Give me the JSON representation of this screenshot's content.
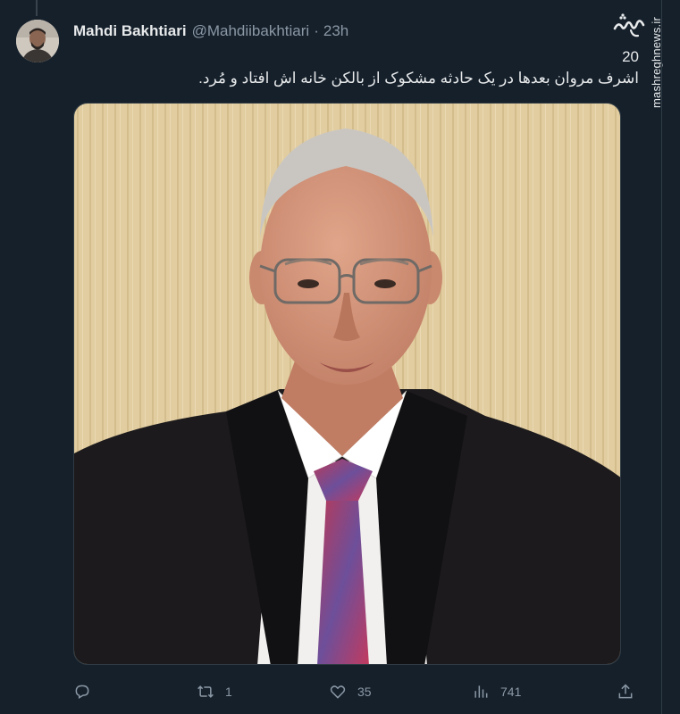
{
  "tweet": {
    "display_name": "Mahdi Bakhtiari",
    "handle": "@Mahdiibakhtiari",
    "separator": "·",
    "time": "23h",
    "number": "20",
    "text": "اشرف مروان بعدها در یک حادثه مشکوک از بالکن خانه اش افتاد و مُرد."
  },
  "watermark": {
    "logo_text": "مشرق",
    "site": "mashreghnews.ir"
  },
  "actions": {
    "reply_count": "",
    "retweet_count": "1",
    "like_count": "35",
    "views_count": "741"
  },
  "colors": {
    "background": "#15202b",
    "text": "#e7e9ea",
    "muted": "#8b98a5",
    "border": "#2f3b45"
  },
  "icons": [
    "reply-icon",
    "retweet-icon",
    "like-icon",
    "views-icon",
    "share-icon"
  ]
}
